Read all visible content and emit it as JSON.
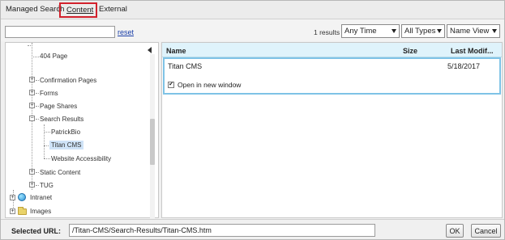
{
  "tabs": {
    "managed_search": "Managed Search",
    "separator": "|",
    "content": "Content",
    "external": "External"
  },
  "toolbar": {
    "search_value": "",
    "reset_label": "reset",
    "results_count": "1 results",
    "time_filter": "Any Time",
    "type_filter": "All Types",
    "view_mode": "Name View"
  },
  "tree": {
    "items": [
      {
        "label": "404 Page",
        "level": 2,
        "expandable": false
      },
      {
        "label": "Confirmation Pages",
        "level": 2,
        "expandable": true
      },
      {
        "label": "Forms",
        "level": 2,
        "expandable": true
      },
      {
        "label": "Page Shares",
        "level": 2,
        "expandable": true
      },
      {
        "label": "Search Results",
        "level": 2,
        "expandable": true,
        "expanded": true
      },
      {
        "label": "PatrickBio",
        "level": 3,
        "expandable": false
      },
      {
        "label": "Titan CMS",
        "level": 3,
        "expandable": false,
        "selected": true
      },
      {
        "label": "Website Accessibility",
        "level": 3,
        "expandable": false
      },
      {
        "label": "Static Content",
        "level": 2,
        "expandable": true
      },
      {
        "label": "TUG",
        "level": 2,
        "expandable": true
      },
      {
        "label": "Intranet",
        "level": 1,
        "expandable": true,
        "icon": "globe-icon"
      },
      {
        "label": "Images",
        "level": 1,
        "expandable": true,
        "icon": "folder-icon"
      }
    ]
  },
  "results": {
    "columns": {
      "name": "Name",
      "size": "Size",
      "modified": "Last Modif..."
    },
    "rows": [
      {
        "name": "Titan CMS",
        "size": "",
        "modified": "5/18/2017",
        "open_new_window_label": "Open in new window",
        "open_new_window_checked": true
      }
    ]
  },
  "bottom": {
    "url_label": "Selected URL:",
    "url_value": "/Titan-CMS/Search-Results/Titan-CMS.htm",
    "ok_label": "OK",
    "cancel_label": "Cancel"
  }
}
